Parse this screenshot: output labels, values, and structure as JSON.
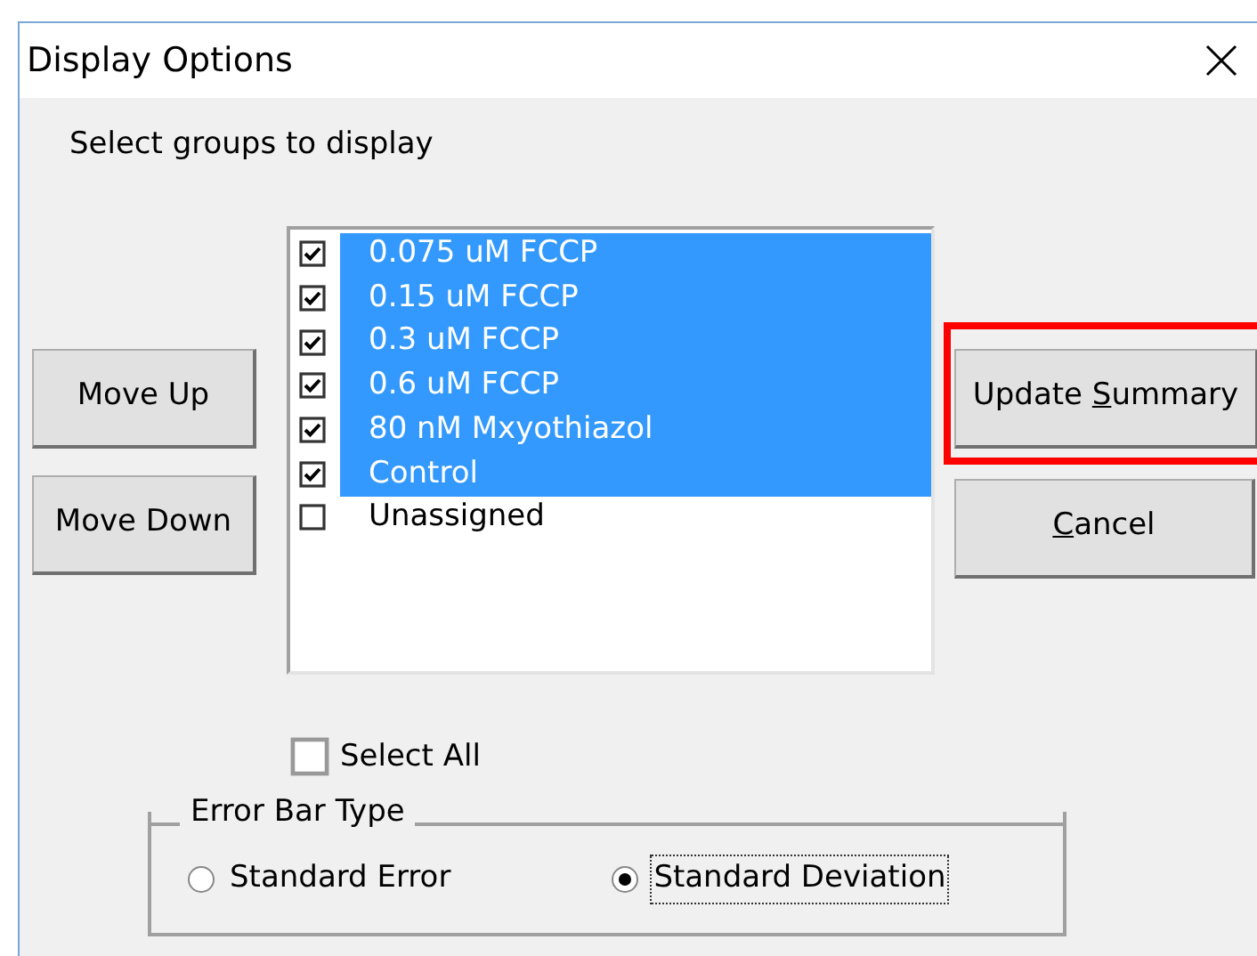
{
  "window": {
    "title": "Display Options"
  },
  "prompt": "Select groups to display",
  "left_buttons": [
    {
      "label": "Move Up"
    },
    {
      "label": "Move Down"
    }
  ],
  "groups": [
    {
      "label": "0.075 uM FCCP",
      "checked": true,
      "selected": true
    },
    {
      "label": "0.15 uM FCCP",
      "checked": true,
      "selected": true
    },
    {
      "label": "0.3 uM FCCP",
      "checked": true,
      "selected": true
    },
    {
      "label": "0.6 uM FCCP",
      "checked": true,
      "selected": true
    },
    {
      "label": "80 nM Mxyothiazol",
      "checked": true,
      "selected": true
    },
    {
      "label": "Control",
      "checked": true,
      "selected": true
    },
    {
      "label": "Unassigned",
      "checked": false,
      "selected": false
    }
  ],
  "right_buttons": [
    {
      "pre": "Update ",
      "key": "S",
      "post": "ummary",
      "highlighted": true
    },
    {
      "key": "C",
      "post": "ancel",
      "highlighted": false
    }
  ],
  "select_all": {
    "label": "Select All",
    "checked": false
  },
  "error_bar_type": {
    "legend": "Error Bar Type",
    "options": [
      {
        "label": "Standard Error",
        "selected": false
      },
      {
        "label": "Standard Deviation",
        "selected": true
      }
    ]
  }
}
